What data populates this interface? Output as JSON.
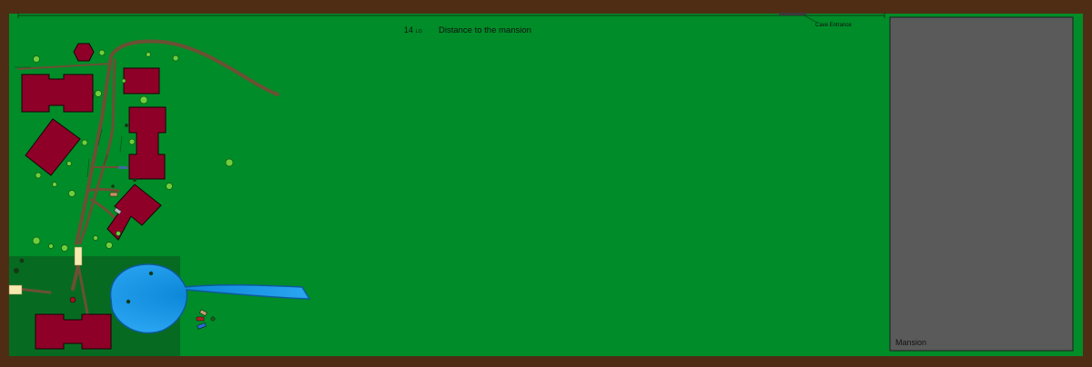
{
  "header": {
    "distance_value": "14",
    "distance_unit": "LO",
    "distance_label": "Distance to the mansion"
  },
  "labels": {
    "cave_entrance": "Cave Entrance",
    "mansion": "Mansion"
  },
  "colors": {
    "border": "#4e2d14",
    "grass": "#008c28",
    "dark_grass": "#066b21",
    "building": "#8e0028",
    "path": "#6b5034",
    "water": "#1e9ff0",
    "water_deep": "#0a86d8",
    "mansion_area": "#5a5a5a",
    "signpost": "#f6eab0"
  }
}
